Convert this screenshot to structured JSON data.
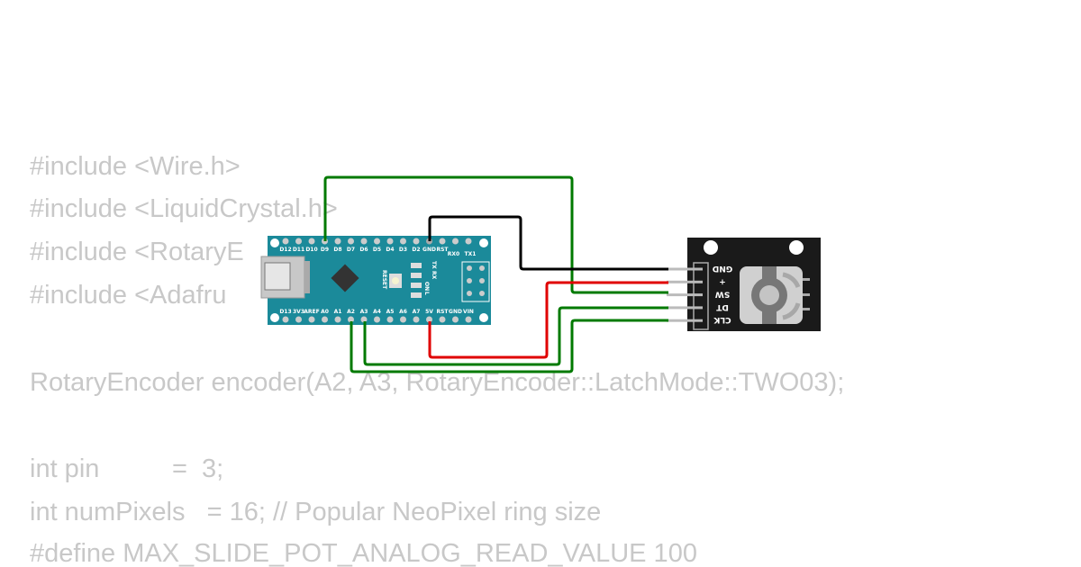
{
  "code_lines": [
    "#include <Wire.h>",
    "#include <LiquidCrystal.h>",
    "#include <RotaryE",
    "#include <Adafru",
    "",
    "RotaryEncoder encoder(A2, A3, RotaryEncoder::LatchMode::TWO03);",
    "",
    "int pin          =  3;",
    "int numPixels   = 16; // Popular NeoPixel ring size",
    "#define MAX_SLIDE_POT_ANALOG_READ_VALUE 100"
  ],
  "nano": {
    "top_pins": [
      "D12",
      "D11",
      "D10",
      "D9",
      "D8",
      "D7",
      "D6",
      "D5",
      "D4",
      "D3",
      "D2",
      "GND",
      "RST",
      "RX0",
      "TX1"
    ],
    "bottom_pins": [
      "D13",
      "3V3",
      "AREF",
      "A0",
      "A1",
      "A2",
      "A3",
      "A4",
      "A5",
      "A6",
      "A7",
      "5V",
      "RST",
      "GND",
      "VIN"
    ],
    "reset_label": "RESET",
    "led_labels": [
      "TX",
      "RX",
      "ON",
      "L"
    ],
    "board_color": "#1b8a9a"
  },
  "encoder": {
    "pins": [
      "GND",
      "+",
      "SW",
      "DT",
      "CLK"
    ],
    "board_color": "#1a1a1a"
  },
  "wire_colors": {
    "green": "#007a00",
    "black": "#000000",
    "red": "#e00000"
  }
}
